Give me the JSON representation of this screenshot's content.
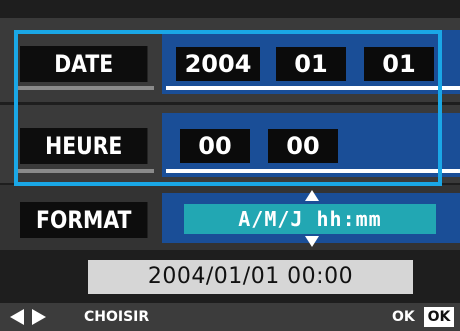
{
  "settings": {
    "date": {
      "label": "DATE",
      "year": "2004",
      "month": "01",
      "day": "01"
    },
    "heure": {
      "label": "HEURE",
      "hour": "00",
      "minute": "00"
    },
    "format": {
      "label": "FORMAT",
      "value": "A/M/J hh:mm"
    }
  },
  "summary": {
    "datetime": "2004/01/01 00:00"
  },
  "footer": {
    "nav_hint": "CHOISIR",
    "ok_hint": "OK",
    "ok_key": "OK"
  },
  "colors": {
    "selection": "#1aa7e6",
    "panel": "#1a4e97",
    "format_field": "#22a7b3"
  }
}
